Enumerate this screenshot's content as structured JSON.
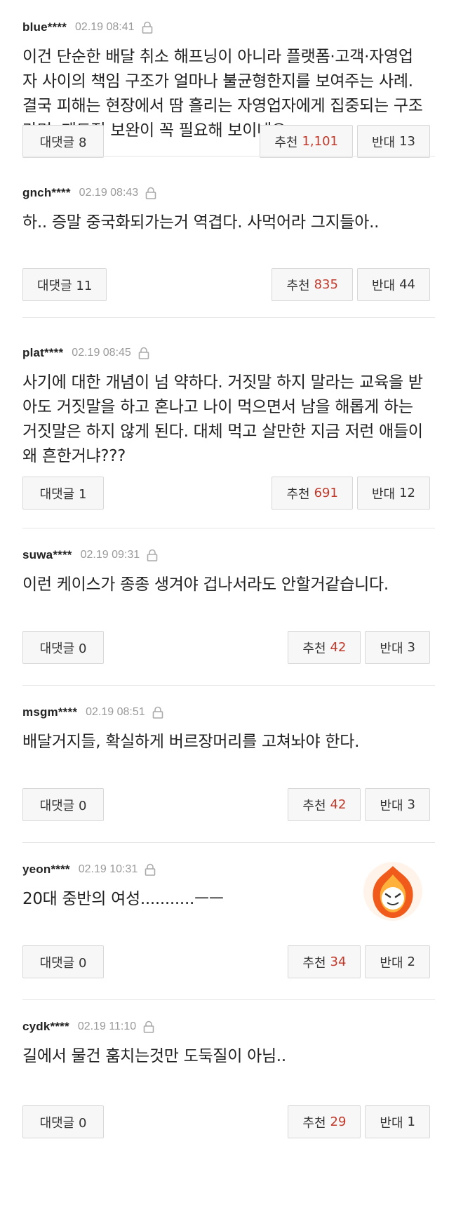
{
  "comments": [
    {
      "user": "blue****",
      "date": "02.19 08:41",
      "text": "이건 단순한 배달 취소 해프닝이 아니라 플랫폼·고객·자영업자 사이의 책임 구조가 얼마나 불균형한지를 보여주는 사례. 결국 피해는 현장에서 땀 흘리는 자영업자에게 집중되는 구조라면, 제도적 보완이 꼭 필요해 보이네요.",
      "reply_label": "대댓글 8",
      "up_label": "추천",
      "up_count": "1,101",
      "down_label": "반대",
      "down_count": "13"
    },
    {
      "user": "gnch****",
      "date": "02.19 08:43",
      "text": "하.. 증말 중국화되가는거 역겹다. 사먹어라 그지들아..",
      "reply_label": "대댓글 11",
      "up_label": "추천",
      "up_count": "835",
      "down_label": "반대",
      "down_count": "44"
    },
    {
      "user": "plat****",
      "date": "02.19 08:45",
      "text": "사기에 대한 개념이 넘 약하다. 거짓말 하지 말라는 교육을 받아도 거짓말을 하고 혼나고 나이 먹으면서 남을 해롭게 하는 거짓말은 하지 않게 된다. 대체 먹고 살만한 지금 저런 애들이 왜 흔한거냐???",
      "reply_label": "대댓글 1",
      "up_label": "추천",
      "up_count": "691",
      "down_label": "반대",
      "down_count": "12"
    },
    {
      "user": "suwa****",
      "date": "02.19 09:31",
      "text": "이런 케이스가 종종 생겨야 겁나서라도 안할거같습니다.",
      "reply_label": "대댓글 0",
      "up_label": "추천",
      "up_count": "42",
      "down_label": "반대",
      "down_count": "3"
    },
    {
      "user": "msgm****",
      "date": "02.19 08:51",
      "text": "배달거지들, 확실하게 버르장머리를 고쳐놔야 한다.",
      "reply_label": "대댓글 0",
      "up_label": "추천",
      "up_count": "42",
      "down_label": "반대",
      "down_count": "3"
    },
    {
      "user": "yeon****",
      "date": "02.19 10:31",
      "text": "20대 중반의 여성...........ㅡㅡ",
      "reply_label": "대댓글 0",
      "up_label": "추천",
      "up_count": "34",
      "down_label": "반대",
      "down_count": "2"
    },
    {
      "user": "cydk****",
      "date": "02.19 11:10",
      "text": "길에서 물건 훔치는것만 도둑질이 아님..",
      "reply_label": "대댓글 0",
      "up_label": "추천",
      "up_count": "29",
      "down_label": "반대",
      "down_count": "1"
    }
  ],
  "icons": {
    "lock": "lock-icon",
    "avatar": "flame-avatar"
  },
  "colors": {
    "accent_count": "#c0392b",
    "meta_gray": "#9a9a9a",
    "button_bg": "#f7f7f7"
  }
}
